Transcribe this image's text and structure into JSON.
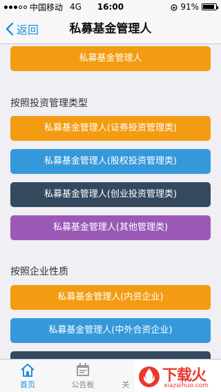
{
  "status_bar": {
    "carrier": "中国移动",
    "network": "4G",
    "time": "16:00",
    "battery_percent": "91%",
    "battery_level": 0.91
  },
  "nav": {
    "back_label": "返回",
    "title": "私募基金管理人"
  },
  "content": {
    "top_button": "私募基金管理人",
    "section1_title": "按照投资管理类型",
    "section1_buttons": [
      "私募基金管理人(证券投资管理类)",
      "私募基金管理人(股权投资管理类)",
      "私募基金管理人(创业投资管理类)",
      "私募基金管理人(其他管理类)"
    ],
    "section2_title": "按照企业性质",
    "section2_buttons": [
      "私募基金管理人(内资企业)",
      "私募基金管理人(中外合资企业)"
    ]
  },
  "tabs": [
    {
      "label": "首页",
      "icon": "home-icon"
    },
    {
      "label": "公告板",
      "icon": "calendar-icon"
    },
    {
      "label": "关",
      "icon": ""
    }
  ],
  "watermark": {
    "text": "下载火",
    "sub": "xiazaihuo.com"
  },
  "colors": {
    "orange": "#f39c12",
    "blue": "#3498db",
    "dark": "#34495e",
    "purple": "#9b59b6",
    "accent": "#1a8fe0"
  }
}
